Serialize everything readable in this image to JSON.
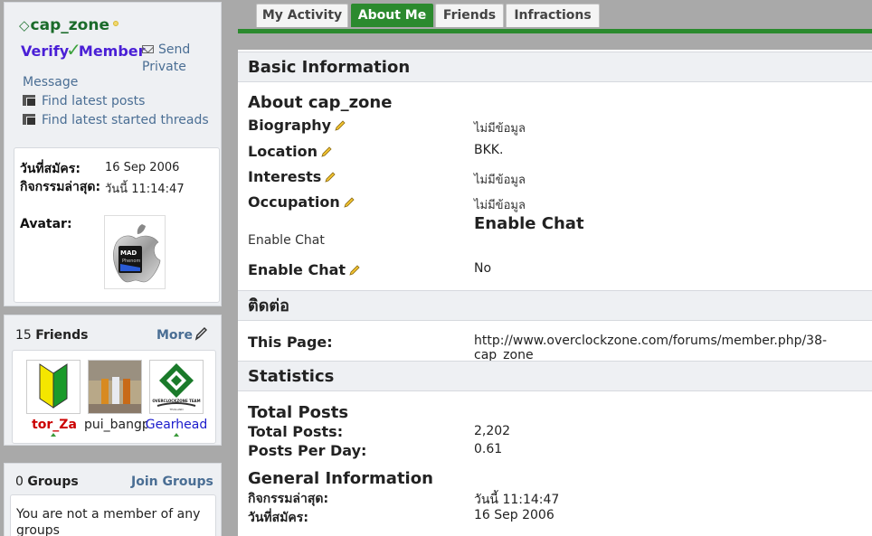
{
  "profile": {
    "username": "cap_zone",
    "rank": "Verify",
    "rank_suffix": "Member",
    "send_pm": "Send Private",
    "message": "Message",
    "find_posts": "Find latest posts",
    "find_threads": "Find latest started threads"
  },
  "details": {
    "joined_label": "วันที่สมัคร:",
    "joined_value": "16 Sep 2006",
    "activity_label": "กิจกรรมล่าสุด:",
    "activity_value": "วันนี้ 11:14:47",
    "avatar_label": "Avatar:",
    "avatar_text": "MAD",
    "avatar_subtext": "Phenom"
  },
  "friends": {
    "count": "15",
    "label": "Friends",
    "more": "More",
    "items": [
      {
        "name": "tor_Za",
        "color": "#cc0000"
      },
      {
        "name": "pui_bangp",
        "color": "#222222"
      },
      {
        "name": "Gearhead",
        "color": "#1a1acc"
      }
    ],
    "logo_text": "OVERCLOCKZONE TEAM",
    "logo_sub": "THAILAND"
  },
  "groups": {
    "count": "0",
    "label": "Groups",
    "join": "Join Groups",
    "empty": "You are not a member of any groups"
  },
  "tabs": [
    "My Activity",
    "About Me",
    "Friends",
    "Infractions"
  ],
  "basic": {
    "header": "Basic Information",
    "about_title": "About cap_zone",
    "fields": [
      {
        "label": "Biography",
        "value": "ไม่มีข้อมูล"
      },
      {
        "label": "Location",
        "value": "BKK."
      },
      {
        "label": "Interests",
        "value": "ไม่มีข้อมูล"
      },
      {
        "label": "Occupation",
        "value": "ไม่มีข้อมูล"
      }
    ],
    "chat_title": "Enable Chat",
    "chat_plain": "Enable Chat",
    "chat_label": "Enable Chat",
    "chat_value": "No"
  },
  "contact": {
    "header": "ติดต่อ",
    "page_label": "This Page:",
    "page_value": "http://www.overclockzone.com/forums/member.php/38-cap_zone"
  },
  "stats": {
    "header": "Statistics",
    "total_title": "Total Posts",
    "total_label": "Total Posts:",
    "total_value": "2,202",
    "ppd_label": "Posts Per Day:",
    "ppd_value": "0.61",
    "general_title": "General Information",
    "activity_label": "กิจกรรมล่าสุด:",
    "activity_value": "วันนี้ 11:14:47",
    "joined_label": "วันที่สมัคร:",
    "joined_value": "16 Sep 2006"
  },
  "colors": {
    "accent": "#2b8a2e",
    "link": "#4a6e94",
    "rank": "#4a1fd6"
  }
}
